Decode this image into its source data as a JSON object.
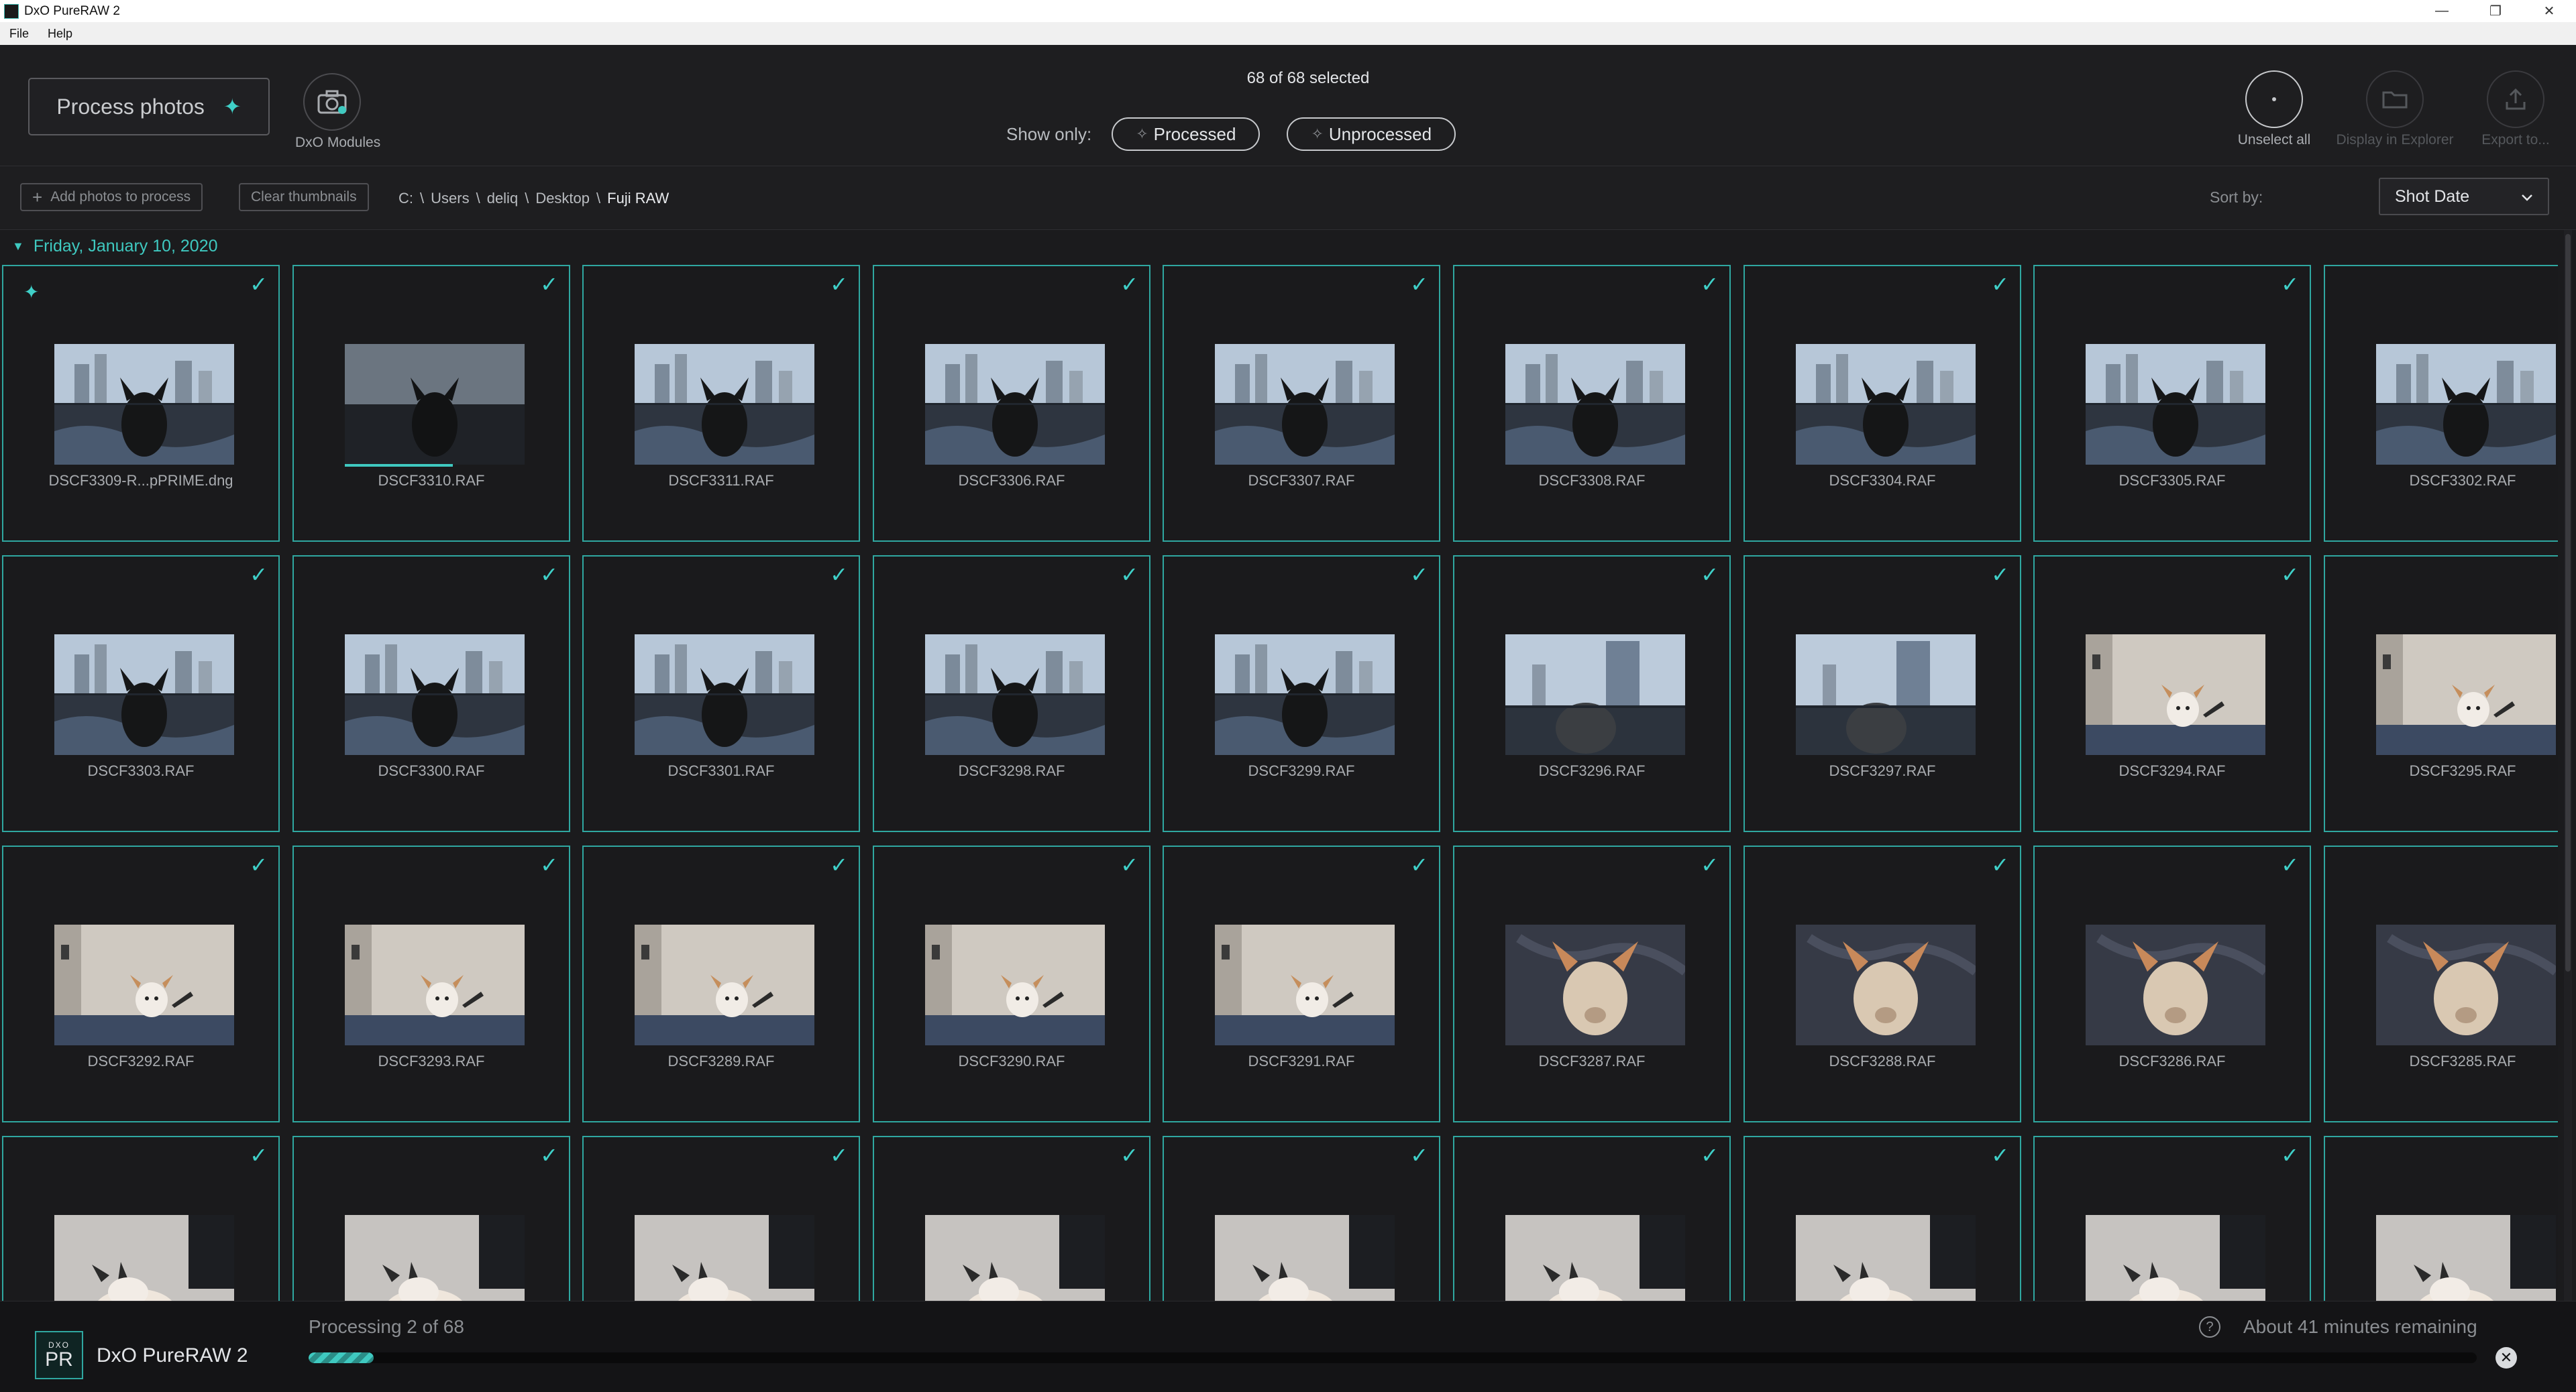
{
  "window": {
    "title": "DxO PureRAW 2",
    "controls": [
      "—",
      "❐",
      "✕"
    ]
  },
  "menu": [
    "File",
    "Help"
  ],
  "toolbar": {
    "process_label": "Process photos",
    "modules_label": "DxO Modules",
    "selected_count": "68 of 68 selected",
    "show_only_label": "Show only:",
    "filter_processed": "Processed",
    "filter_unprocessed": "Unprocessed",
    "unselect_all": "Unselect all",
    "display_in_explorer": "Display in Explorer",
    "export_to": "Export to..."
  },
  "subbar": {
    "add_photos": "Add photos to process",
    "clear_thumbnails": "Clear thumbnails",
    "path": [
      "C:",
      "Users",
      "deliq",
      "Desktop",
      "Fuji RAW"
    ],
    "sort_label": "Sort by:",
    "sort_value": "Shot Date"
  },
  "group": {
    "date": "Friday, January 10, 2020"
  },
  "photos": [
    {
      "name": "DSCF3309-R...pPRIME.dng",
      "scene": "window",
      "processed": true
    },
    {
      "name": "DSCF3310.RAF",
      "scene": "window-dark",
      "progress": 0.6
    },
    {
      "name": "DSCF3311.RAF",
      "scene": "window"
    },
    {
      "name": "DSCF3306.RAF",
      "scene": "window"
    },
    {
      "name": "DSCF3307.RAF",
      "scene": "window"
    },
    {
      "name": "DSCF3308.RAF",
      "scene": "window"
    },
    {
      "name": "DSCF3304.RAF",
      "scene": "window"
    },
    {
      "name": "DSCF3305.RAF",
      "scene": "window"
    },
    {
      "name": "DSCF3302.RAF",
      "scene": "window"
    },
    {
      "name": "DSCF3303.RAF",
      "scene": "window"
    },
    {
      "name": "DSCF3300.RAF",
      "scene": "window"
    },
    {
      "name": "DSCF3301.RAF",
      "scene": "window"
    },
    {
      "name": "DSCF3298.RAF",
      "scene": "window"
    },
    {
      "name": "DSCF3299.RAF",
      "scene": "window"
    },
    {
      "name": "DSCF3296.RAF",
      "scene": "window-back"
    },
    {
      "name": "DSCF3297.RAF",
      "scene": "window-back"
    },
    {
      "name": "DSCF3294.RAF",
      "scene": "wall"
    },
    {
      "name": "DSCF3295.RAF",
      "scene": "wall"
    },
    {
      "name": "DSCF3292.RAF",
      "scene": "wall"
    },
    {
      "name": "DSCF3293.RAF",
      "scene": "wall"
    },
    {
      "name": "DSCF3289.RAF",
      "scene": "wall"
    },
    {
      "name": "DSCF3290.RAF",
      "scene": "wall"
    },
    {
      "name": "DSCF3291.RAF",
      "scene": "wall"
    },
    {
      "name": "DSCF3287.RAF",
      "scene": "bed"
    },
    {
      "name": "DSCF3288.RAF",
      "scene": "bed"
    },
    {
      "name": "DSCF3286.RAF",
      "scene": "bed"
    },
    {
      "name": "DSCF3285.RAF",
      "scene": "bed"
    },
    {
      "name": "",
      "scene": "lying"
    },
    {
      "name": "",
      "scene": "lying"
    },
    {
      "name": "",
      "scene": "lying"
    },
    {
      "name": "",
      "scene": "lying"
    },
    {
      "name": "",
      "scene": "lying"
    },
    {
      "name": "",
      "scene": "lying"
    },
    {
      "name": "",
      "scene": "lying"
    },
    {
      "name": "",
      "scene": "lying"
    },
    {
      "name": "",
      "scene": "lying"
    }
  ],
  "footer": {
    "logo_top": "DXO",
    "logo_main": "PR",
    "app_name": "DxO PureRAW 2",
    "processing": "Processing 2 of 68",
    "remaining": "About 41 minutes remaining",
    "progress_fraction": 0.03
  },
  "colors": {
    "accent": "#3fc9c0",
    "tile_border": "#2fa7a0",
    "background": "#1b1b1d"
  }
}
